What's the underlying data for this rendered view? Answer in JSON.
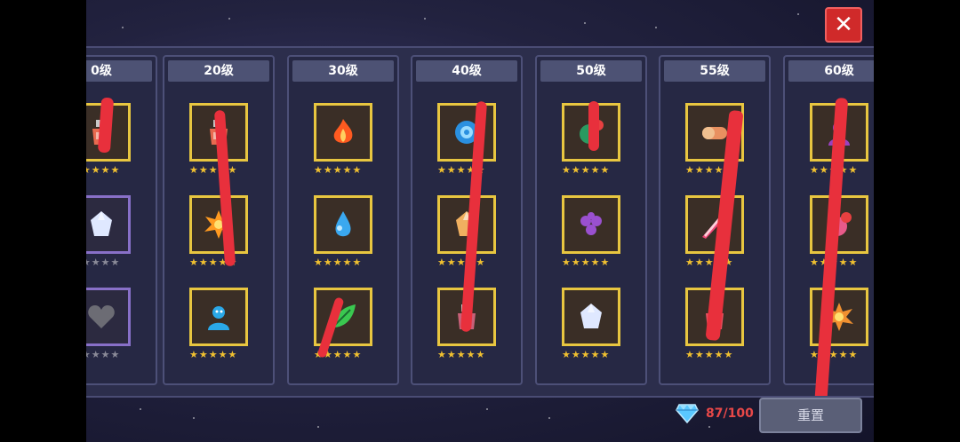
{
  "columns": [
    {
      "label": "0级",
      "tiles": [
        {
          "icon": "red-potion-icon",
          "color": "#e86a50",
          "stars": 5,
          "locked": false
        },
        {
          "icon": "white-crystal-icon",
          "color": "#dfe8ff",
          "stars": 0,
          "locked": true
        },
        {
          "icon": "gray-heart-icon",
          "color": "#6c6c74",
          "stars": 0,
          "locked": true
        }
      ]
    },
    {
      "label": "20级",
      "tiles": [
        {
          "icon": "red-potion-icon",
          "color": "#e86a50",
          "stars": 5,
          "locked": false
        },
        {
          "icon": "explosion-icon",
          "color": "#ff9a20",
          "stars": 5,
          "locked": false
        },
        {
          "icon": "shadow-figure-icon",
          "color": "#2aa8e8",
          "stars": 5,
          "locked": false
        }
      ]
    },
    {
      "label": "30级",
      "tiles": [
        {
          "icon": "fire-icon",
          "color": "#ff5a20",
          "stars": 5,
          "locked": false
        },
        {
          "icon": "water-drop-icon",
          "color": "#3aa8f0",
          "stars": 5,
          "locked": false
        },
        {
          "icon": "leaf-icon",
          "color": "#3ac850",
          "stars": 5,
          "locked": false
        }
      ]
    },
    {
      "label": "40级",
      "tiles": [
        {
          "icon": "blue-swirl-icon",
          "color": "#2a90e0",
          "stars": 5,
          "locked": false
        },
        {
          "icon": "orange-crystal-icon",
          "color": "#f0b060",
          "stars": 5,
          "locked": false
        },
        {
          "icon": "pink-potion-icon",
          "color": "#c86078",
          "stars": 5,
          "locked": false
        }
      ]
    },
    {
      "label": "50级",
      "tiles": [
        {
          "icon": "green-red-orb-icon",
          "color": "#2a9a60",
          "stars": 5,
          "locked": false
        },
        {
          "icon": "purple-grape-icon",
          "color": "#9a50d0",
          "stars": 5,
          "locked": false
        },
        {
          "icon": "white-crystal-icon",
          "color": "#dfe8ff",
          "stars": 5,
          "locked": false
        }
      ]
    },
    {
      "label": "55级",
      "tiles": [
        {
          "icon": "orange-capsule-icon",
          "color": "#e89060",
          "stars": 5,
          "locked": false
        },
        {
          "icon": "pink-blade-icon",
          "color": "#f04878",
          "stars": 5,
          "locked": false
        },
        {
          "icon": "red-potion-icon",
          "color": "#e85060",
          "stars": 5,
          "locked": false
        }
      ]
    },
    {
      "label": "60级",
      "tiles": [
        {
          "icon": "purple-shadow-icon",
          "color": "#9a40c0",
          "stars": 5,
          "locked": false
        },
        {
          "icon": "pink-orb-icon",
          "color": "#e85a8a",
          "stars": 5,
          "locked": false
        },
        {
          "icon": "orange-burst-icon",
          "color": "#f09030",
          "stars": 5,
          "locked": false
        }
      ]
    }
  ],
  "gems": {
    "count": "87/100",
    "icon": "diamond-icon",
    "color": "#5ac8ff"
  },
  "reset_label": "重置",
  "close_label": "✕",
  "colors": {
    "border_gold": "#e8c640",
    "border_locked": "#8870c8",
    "star_on": "#f0c030",
    "star_off": "#8a8a98",
    "scribble": "#e8303c"
  }
}
